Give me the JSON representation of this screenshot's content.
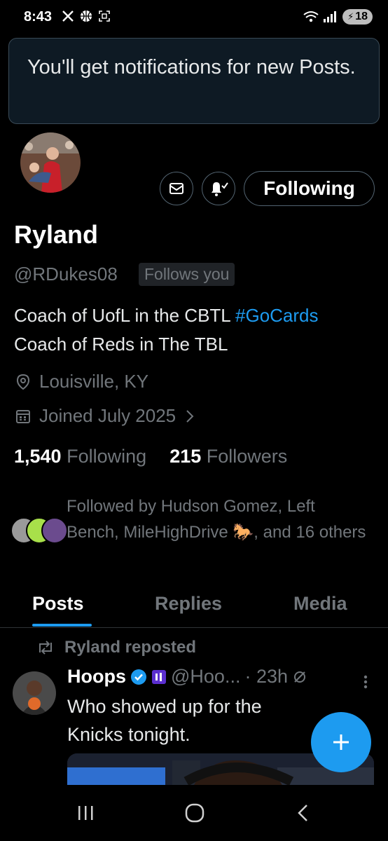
{
  "status_bar": {
    "time": "8:43",
    "battery": "18"
  },
  "toast": {
    "message": "You'll get notifications for new Posts."
  },
  "profile": {
    "name": "Ryland",
    "handle": "@RDukes08",
    "follows_you_label": "Follows you",
    "follow_button_label": "Following",
    "bio_line1_text": "Coach of UofL in the CBTL ",
    "bio_line1_hashtag": "#GoCards",
    "bio_line2": "Coach of Reds in The TBL",
    "location": "Louisville, KY",
    "joined": "Joined July 2025",
    "following_count": "1,540",
    "following_label": "Following",
    "followers_count": "215",
    "followers_label": "Followers",
    "followed_by_text": "Followed by Hudson Gomez, Left Bench, MileHighDrive 🐎, and 16 others"
  },
  "tabs": [
    {
      "label": "Posts",
      "active": true
    },
    {
      "label": "Replies",
      "active": false
    },
    {
      "label": "Media",
      "active": false
    }
  ],
  "post": {
    "repost_label": "Ryland reposted",
    "author_name": "Hoops",
    "author_handle": "@Hoo...",
    "time": "· 23h",
    "text": "Who showed up for the Knicks tonight."
  },
  "icons": {
    "mail": "mail-icon",
    "bell": "bell-check-icon",
    "location": "location-pin-icon",
    "calendar": "calendar-icon",
    "chevron": "chevron-right-icon",
    "repost": "repost-icon",
    "verified": "verified-badge-icon",
    "more": "more-vertical-icon",
    "compose": "plus-icon"
  },
  "colors": {
    "background": "#000000",
    "accent": "#1d9bf0",
    "secondary_text": "#71767b",
    "border": "#536471"
  }
}
